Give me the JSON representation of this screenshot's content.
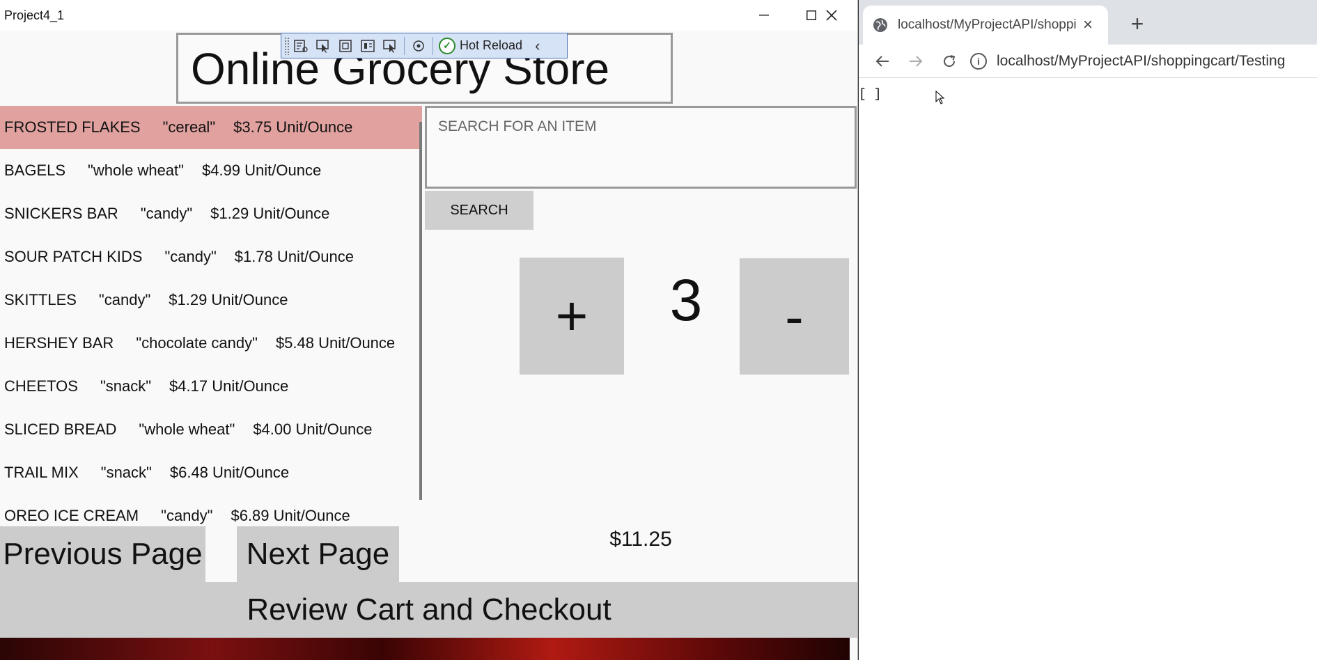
{
  "app": {
    "title": "Project4_1",
    "store_title": "Online Grocery Store",
    "hot_reload": {
      "label": "Hot Reload",
      "collapse": "‹"
    },
    "products": [
      {
        "name": "FROSTED FLAKES",
        "category": "\"cereal\"",
        "price": "$3.75 Unit/Ounce",
        "selected": true
      },
      {
        "name": "BAGELS",
        "category": "\"whole wheat\"",
        "price": "$4.99 Unit/Ounce"
      },
      {
        "name": "SNICKERS BAR",
        "category": "\"candy\"",
        "price": "$1.29 Unit/Ounce"
      },
      {
        "name": "SOUR PATCH KIDS",
        "category": "\"candy\"",
        "price": "$1.78 Unit/Ounce"
      },
      {
        "name": "SKITTLES",
        "category": "\"candy\"",
        "price": "$1.29 Unit/Ounce"
      },
      {
        "name": "HERSHEY BAR",
        "category": "\"chocolate candy\"",
        "price": "$5.48 Unit/Ounce"
      },
      {
        "name": "CHEETOS",
        "category": "\"snack\"",
        "price": "$4.17 Unit/Ounce"
      },
      {
        "name": "SLICED BREAD",
        "category": "\"whole wheat\"",
        "price": "$4.00 Unit/Ounce"
      },
      {
        "name": "TRAIL MIX",
        "category": "\"snack\"",
        "price": "$6.48 Unit/Ounce"
      },
      {
        "name": "OREO ICE CREAM",
        "category": "\"candy\"",
        "price": "$6.89 Unit/Ounce"
      }
    ],
    "search": {
      "placeholder": "SEARCH FOR AN ITEM",
      "value": "",
      "button_label": "SEARCH"
    },
    "quantity": {
      "plus_label": "+",
      "value": "3",
      "minus_label": "-"
    },
    "total": "$11.25",
    "nav": {
      "previous_label": "Previous Page",
      "next_label": "Next Page"
    },
    "checkout_label": "Review Cart and Checkout",
    "colors": {
      "selected_row": "#e0a19f",
      "button_gray": "#cccccc"
    }
  },
  "browser": {
    "tab_title": "localhost/MyProjectAPI/shoppingcart/Testing",
    "tab_close": "×",
    "new_tab": "+",
    "url": "localhost/MyProjectAPI/shoppingcart/Testing",
    "body_text": "[ ]",
    "icons": [
      "globe-icon",
      "back-icon",
      "forward-icon",
      "reload-icon",
      "info-icon"
    ]
  }
}
